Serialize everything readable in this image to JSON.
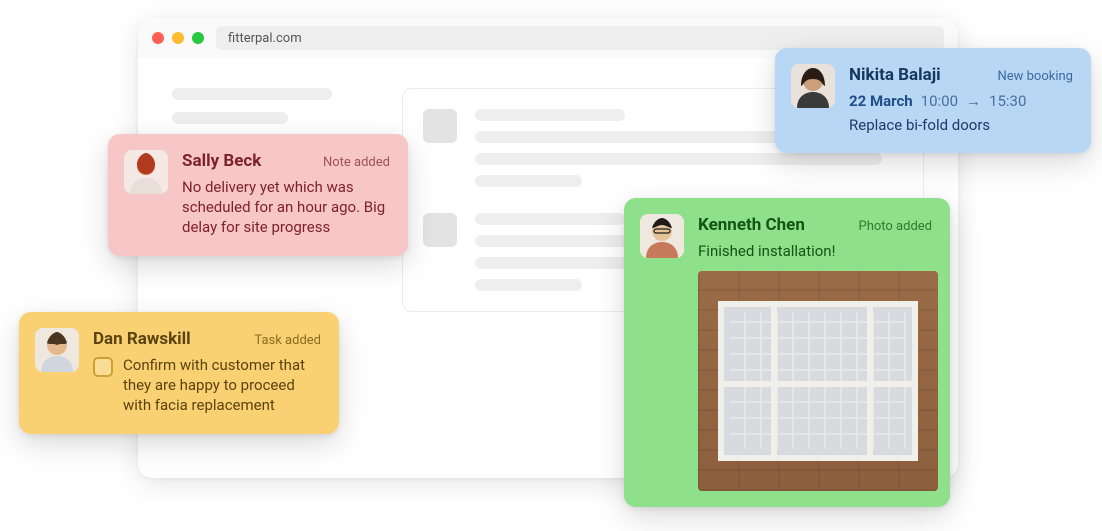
{
  "browser": {
    "url": "fitterpal.com"
  },
  "cards": {
    "sally": {
      "name": "Sally Beck",
      "badge": "Note added",
      "message": "No delivery yet which was scheduled for an hour ago. Big delay for site progress"
    },
    "dan": {
      "name": "Dan Rawskill",
      "badge": "Task added",
      "task": "Confirm with customer that they are happy to proceed with facia replacement"
    },
    "nikita": {
      "name": "Nikita Balaji",
      "badge": "New booking",
      "date": "22 March",
      "time_start": "10:00",
      "time_end": "15:30",
      "arrow": "→",
      "job": "Replace bi-fold doors"
    },
    "kenneth": {
      "name": "Kenneth Chen",
      "badge": "Photo added",
      "message": "Finished installation!"
    }
  }
}
